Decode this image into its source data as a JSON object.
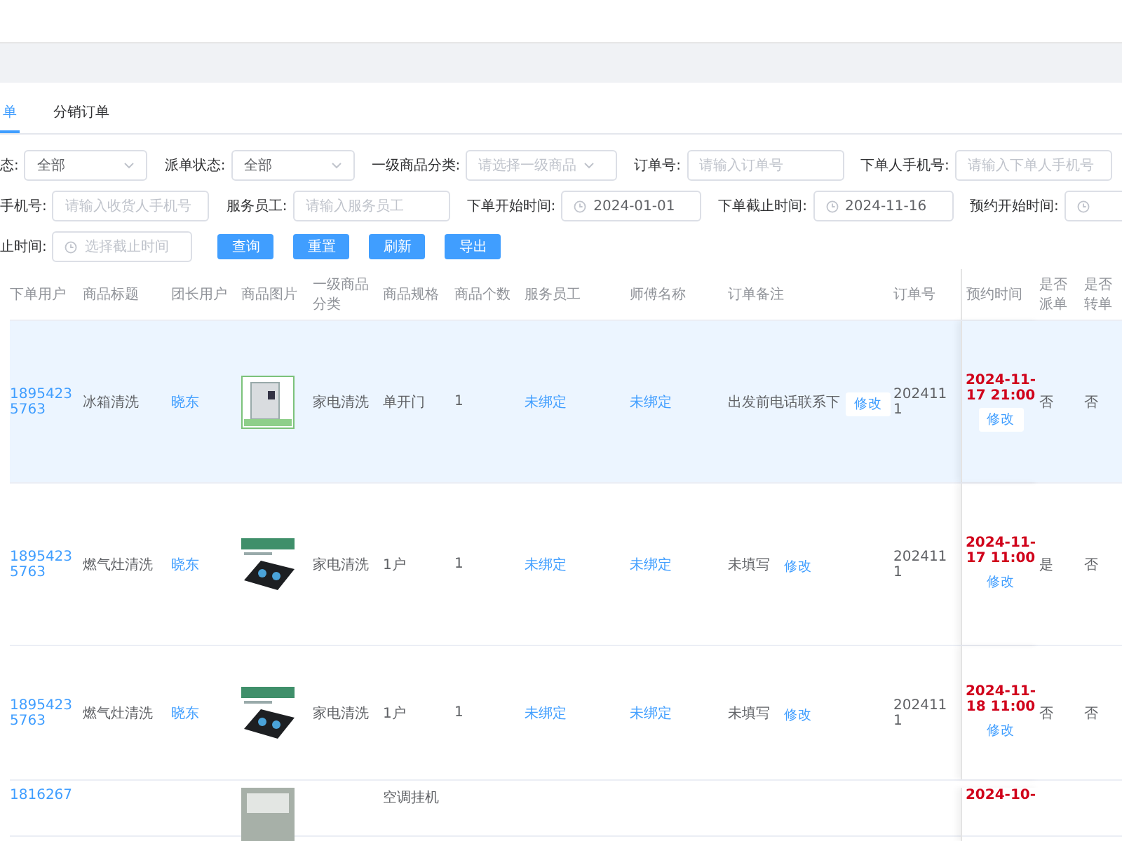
{
  "tabs": [
    {
      "label": "单",
      "selected": true
    },
    {
      "label": "分销订单",
      "selected": false
    }
  ],
  "filters": [
    [
      {
        "label": "态:",
        "kind": "select",
        "value": "全部"
      },
      {
        "label": "派单状态:",
        "kind": "select",
        "value": "全部"
      },
      {
        "label": "一级商品分类:",
        "kind": "select",
        "placeholder": "请选择一级商品"
      },
      {
        "label": "订单号:",
        "kind": "input",
        "placeholder": "请输入订单号"
      },
      {
        "label": "下单人手机号:",
        "kind": "input",
        "placeholder": "请输入下单人手机号"
      }
    ],
    [
      {
        "label": "手机号:",
        "kind": "input",
        "placeholder": "请输入收货人手机号"
      },
      {
        "label": "服务员工:",
        "kind": "input",
        "placeholder": "请输入服务员工"
      },
      {
        "label": "下单开始时间:",
        "kind": "date",
        "value": "2024-01-01"
      },
      {
        "label": "下单截止时间:",
        "kind": "date",
        "value": "2024-11-16"
      },
      {
        "label": "预约开始时间:",
        "kind": "date"
      }
    ],
    [
      {
        "label": "止时间:",
        "kind": "date",
        "placeholder": "选择截止时间"
      }
    ]
  ],
  "buttons": [
    "查询",
    "重置",
    "刷新",
    "导出"
  ],
  "columns": [
    "下单用户",
    "商品标题",
    "团长用户",
    "商品图片",
    "一级商品分类",
    "商品规格",
    "商品个数",
    "服务员工",
    "师傅名称",
    "订单备注",
    "订单号",
    "预约时间",
    "是否派单",
    "是否转单"
  ],
  "rows": [
    {
      "selected": true,
      "user": "18954235763",
      "title": "冰箱清洗",
      "leader": "晓东",
      "kind": "fridge",
      "category": "家电清洗",
      "spec": "单开门",
      "count": "1",
      "staff": "未绑定",
      "master": "未绑定",
      "remark": "出发前电话联系下",
      "remark_edit": "修改",
      "order_no": "2024111",
      "time": "2024-11-17 21:00",
      "time_edit": "修改",
      "dispatched": "否",
      "transferred": "否"
    },
    {
      "selected": false,
      "user": "18954235763",
      "title": "燃气灶清洗",
      "leader": "晓东",
      "kind": "stove",
      "category": "家电清洗",
      "spec": "1户",
      "count": "1",
      "staff": "未绑定",
      "master": "未绑定",
      "remark": "未填写",
      "remark_edit": "修改",
      "order_no": "2024111",
      "time": "2024-11-17 11:00",
      "time_edit": "修改",
      "dispatched": "是",
      "transferred": "否"
    },
    {
      "selected": false,
      "user": "18954235763",
      "title": "燃气灶清洗",
      "leader": "晓东",
      "kind": "stove",
      "category": "家电清洗",
      "spec": "1户",
      "count": "1",
      "staff": "未绑定",
      "master": "未绑定",
      "remark": "未填写",
      "remark_edit": "修改",
      "order_no": "2024111",
      "time": "2024-11-18 11:00",
      "time_edit": "修改",
      "dispatched": "否",
      "transferred": "否"
    },
    {
      "selected": false,
      "user": "1816267",
      "kind": "ac",
      "spec": "空调挂机",
      "time": "2024-10-"
    }
  ]
}
